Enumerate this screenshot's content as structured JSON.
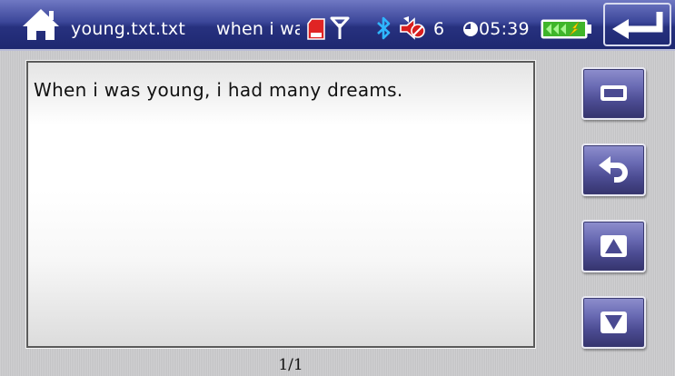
{
  "status_bar": {
    "file_name": "young.txt.txt",
    "text_preview": "when i was young",
    "volume_level": "6",
    "time": "05:39",
    "icons": [
      "home-icon",
      "sd-card-icon",
      "antenna-icon",
      "bluetooth-icon",
      "volume-icon",
      "clock-icon",
      "battery-charging-icon",
      "back-arrow-icon"
    ]
  },
  "viewer": {
    "text": "When i was young, i had many dreams.",
    "page_indicator": "1/1"
  },
  "side_buttons": [
    {
      "name": "fullscreen-button",
      "icon": "fullscreen-icon"
    },
    {
      "name": "return-button",
      "icon": "return-arrow-icon"
    },
    {
      "name": "page-up-button",
      "icon": "triangle-up-icon"
    },
    {
      "name": "page-down-button",
      "icon": "triangle-down-icon"
    }
  ],
  "colors": {
    "title_bar": "#2a3487",
    "button_face": "#5c5ca6",
    "battery": "#4ee23a",
    "sd_card": "#e02020"
  }
}
